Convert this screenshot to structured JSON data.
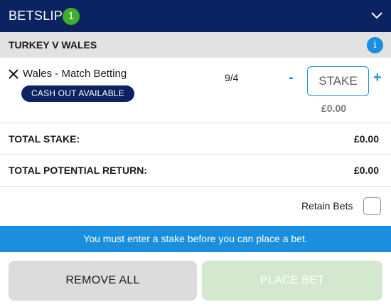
{
  "header": {
    "title": "BETSLIP",
    "count": "1",
    "toggle_icon": "chevron-down-icon"
  },
  "event": {
    "name": "TURKEY V WALES",
    "info_icon_glyph": "i"
  },
  "bet": {
    "selection": "Wales - Match Betting",
    "cashout_label": "CASH OUT AVAILABLE",
    "odds": "9/4",
    "minus_label": "-",
    "plus_label": "+",
    "stake_placeholder": "STAKE",
    "stake_value": "",
    "potential_return": "£0.00"
  },
  "summary": {
    "total_stake_label": "TOTAL STAKE:",
    "total_stake_value": "£0.00",
    "total_return_label": "TOTAL POTENTIAL RETURN:",
    "total_return_value": "£0.00"
  },
  "retain": {
    "label": "Retain Bets",
    "checked": false
  },
  "notice": "You must enter a stake before you can place a bet.",
  "actions": {
    "remove_all": "REMOVE ALL",
    "place_bet": "PLACE BET"
  },
  "colors": {
    "header_bg": "#0b2360",
    "count_badge": "#3fae2a",
    "accent_blue": "#1a8fdd",
    "place_bet_disabled": "#d3e8cf"
  }
}
